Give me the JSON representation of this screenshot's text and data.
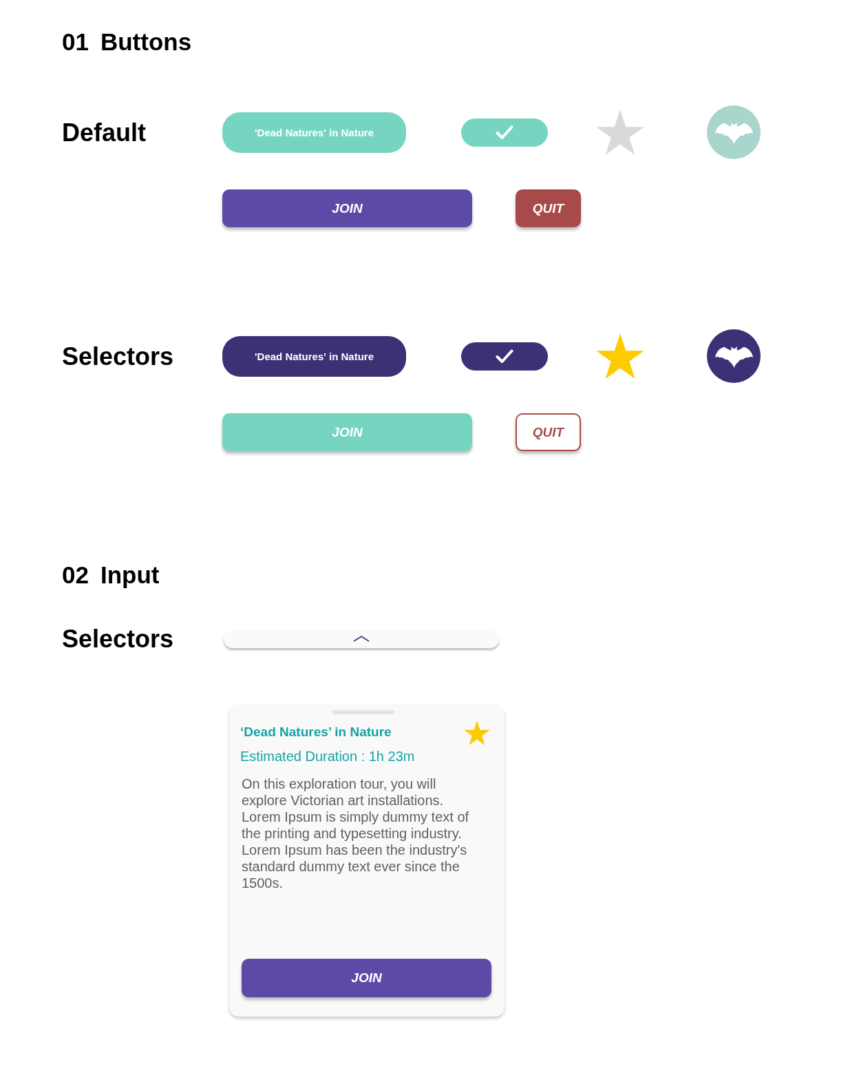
{
  "buttons_section": {
    "number": "01",
    "title": "Buttons",
    "rows": [
      {
        "label": "Default",
        "tag": {
          "label": "'Dead Natures' in Nature",
          "selected": false
        },
        "check_toggle": {
          "selected": false
        },
        "star": {
          "selected": false
        },
        "bat_toggle": {
          "selected": false
        },
        "join": {
          "label": "JOIN",
          "selected": false
        },
        "quit": {
          "label": "QUIT",
          "selected": false
        }
      },
      {
        "label": "Selectors",
        "tag": {
          "label": "'Dead Natures' in Nature",
          "selected": true
        },
        "check_toggle": {
          "selected": true
        },
        "star": {
          "selected": true
        },
        "bat_toggle": {
          "selected": true
        },
        "join": {
          "label": "JOIN",
          "selected": true
        },
        "quit": {
          "label": "QUIT",
          "selected": true
        }
      }
    ]
  },
  "input_section": {
    "number": "02",
    "title": "Input",
    "label": "Selectors",
    "drawer_handle": {
      "expanded": false
    },
    "tour_card": {
      "title": "‘Dead Natures’ in Nature",
      "favorite": {
        "selected": true
      },
      "duration": "Estimated Duration : 1h 23m",
      "description": "On this exploration tour, you will explore Victorian art installations. Lorem Ipsum is simply dummy text of the printing and typesetting industry. Lorem Ipsum has been the industry's standard dummy text ever since the 1500s.",
      "join": {
        "label": "JOIN",
        "selected": false
      }
    }
  }
}
